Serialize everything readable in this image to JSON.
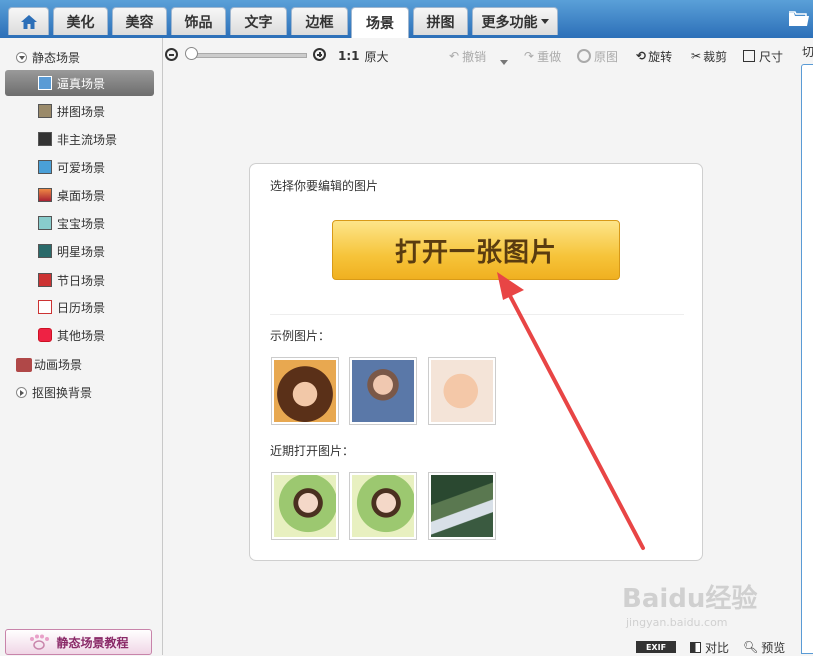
{
  "tabs": [
    {
      "label": "美化"
    },
    {
      "label": "美容"
    },
    {
      "label": "饰品"
    },
    {
      "label": "文字"
    },
    {
      "label": "边框"
    },
    {
      "label": "场景"
    },
    {
      "label": "拼图"
    },
    {
      "label": "更多功能"
    }
  ],
  "sidebar": {
    "static_group": "静态场景",
    "items": [
      {
        "label": "逼真场景"
      },
      {
        "label": "拼图场景"
      },
      {
        "label": "非主流场景"
      },
      {
        "label": "可爱场景"
      },
      {
        "label": "桌面场景"
      },
      {
        "label": "宝宝场景"
      },
      {
        "label": "明星场景"
      },
      {
        "label": "节日场景"
      },
      {
        "label": "日历场景"
      },
      {
        "label": "其他场景"
      }
    ],
    "animated_group": "动画场景",
    "cutout_group": "抠图换背景",
    "tutorial_label": "静态场景教程"
  },
  "toolbar": {
    "ratio": "1:1",
    "original_size": "原大",
    "undo": "撤销",
    "redo": "重做",
    "original_image": "原图",
    "rotate": "旋转",
    "crop": "裁剪",
    "size": "尺寸"
  },
  "right_panel": {
    "label": "切"
  },
  "main": {
    "prompt": "选择你要编辑的图片",
    "open_button": "打开一张图片",
    "samples_label": "示例图片：",
    "recent_label": "近期打开图片："
  },
  "statusbar": {
    "exif": "EXIF",
    "compare": "对比",
    "preview": "预览"
  },
  "watermark": {
    "brand": "Baidu经验",
    "url": "jingyan.baidu.com"
  },
  "colors": {
    "topbar": "#3a7fc6",
    "open_button": "#f7c540",
    "arrow": "#e84545"
  }
}
